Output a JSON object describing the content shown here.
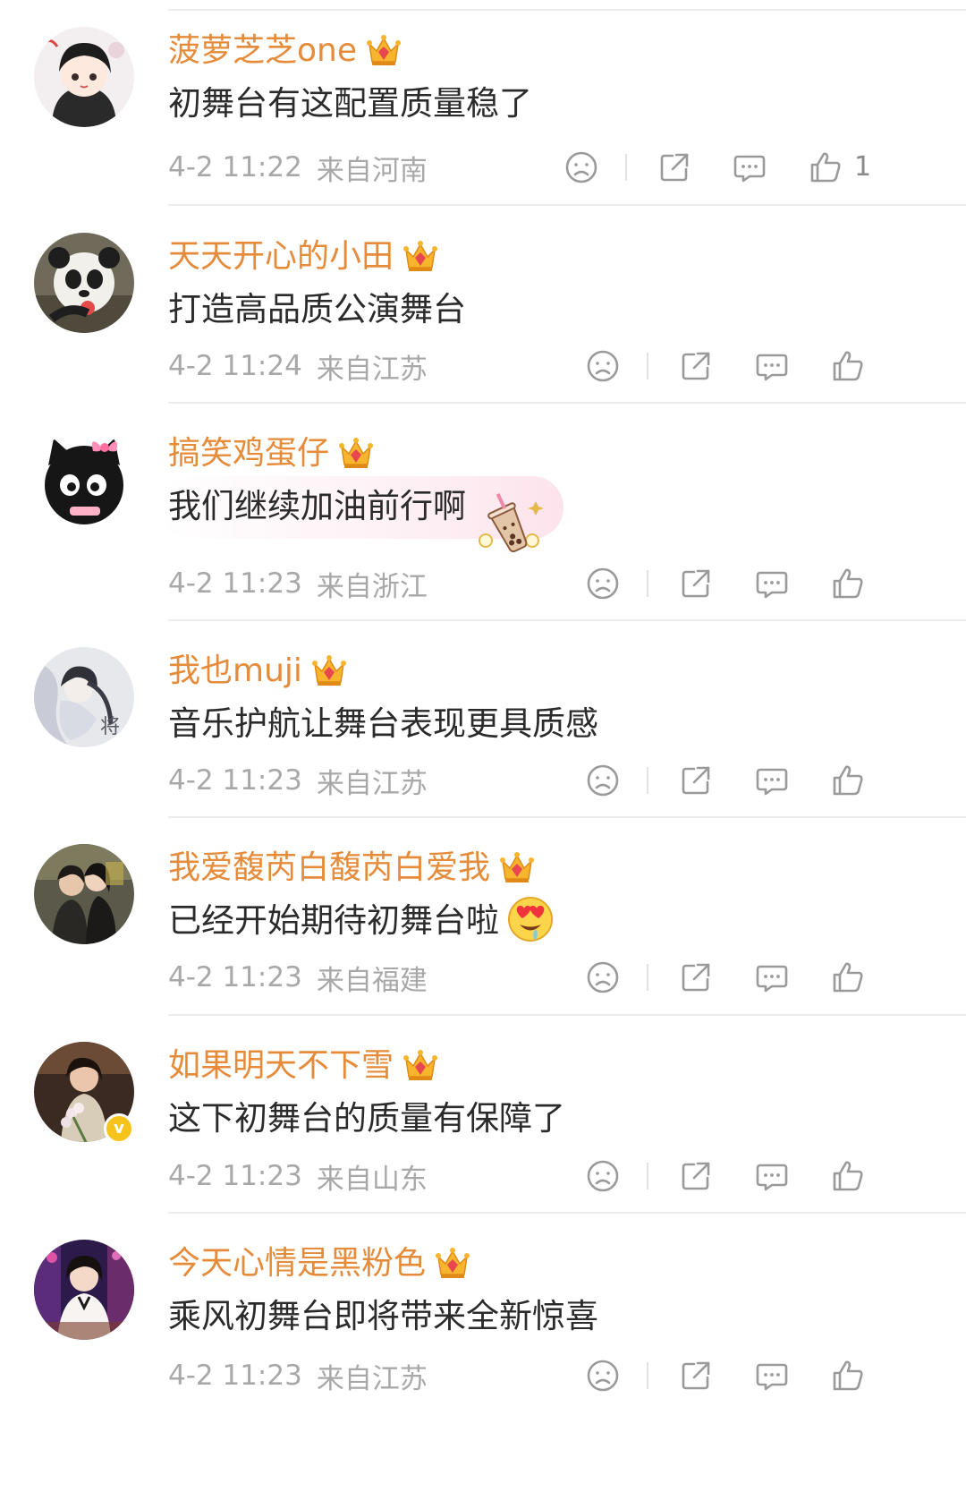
{
  "comments": [
    {
      "username": "菠萝芝芝one",
      "text": "初舞台有这配置质量稳了",
      "time": "4-2 11:22",
      "location": "来自河南",
      "likes": "1",
      "avatar": "anime-girl-avatar"
    },
    {
      "username": "天天开心的小田",
      "text": "打造高品质公演舞台",
      "time": "4-2 11:24",
      "location": "来自江苏",
      "likes": "",
      "avatar": "panda-avatar"
    },
    {
      "username": "搞笑鸡蛋仔",
      "text": "我们继续加油前行啊",
      "time": "4-2 11:23",
      "location": "来自浙江",
      "likes": "",
      "avatar": "black-cat-avatar",
      "sticker": "bubble-tea-sticker"
    },
    {
      "username": "我也muji",
      "text": "音乐护航让舞台表现更具质感",
      "time": "4-2 11:23",
      "location": "来自江苏",
      "likes": "",
      "avatar": "ink-illustration-avatar"
    },
    {
      "username": "我爱馥芮白馥芮白爱我",
      "text": "已经开始期待初舞台啦",
      "time": "4-2 11:23",
      "location": "来自福建",
      "likes": "",
      "avatar": "couple-photo-avatar",
      "emoji": "heart-eyes-emoji"
    },
    {
      "username": "如果明天不下雪",
      "text": "这下初舞台的质量有保障了",
      "time": "4-2 11:23",
      "location": "来自山东",
      "likes": "",
      "avatar": "woman-flowers-avatar",
      "verified": true
    },
    {
      "username": "今天心情是黑粉色",
      "text": "乘风初舞台即将带来全新惊喜",
      "time": "4-2 11:23",
      "location": "来自江苏",
      "likes": "",
      "avatar": "woman-white-dress-avatar"
    }
  ],
  "icons": {
    "crown": "crown-badge-icon",
    "dislike": "sad-face-icon",
    "share": "share-icon",
    "reply": "comment-icon",
    "like": "thumbs-up-icon"
  },
  "colors": {
    "username": "#e58b3a",
    "text": "#2b2b2b",
    "meta": "#a8a8a8",
    "icon": "#9a9a9a"
  }
}
